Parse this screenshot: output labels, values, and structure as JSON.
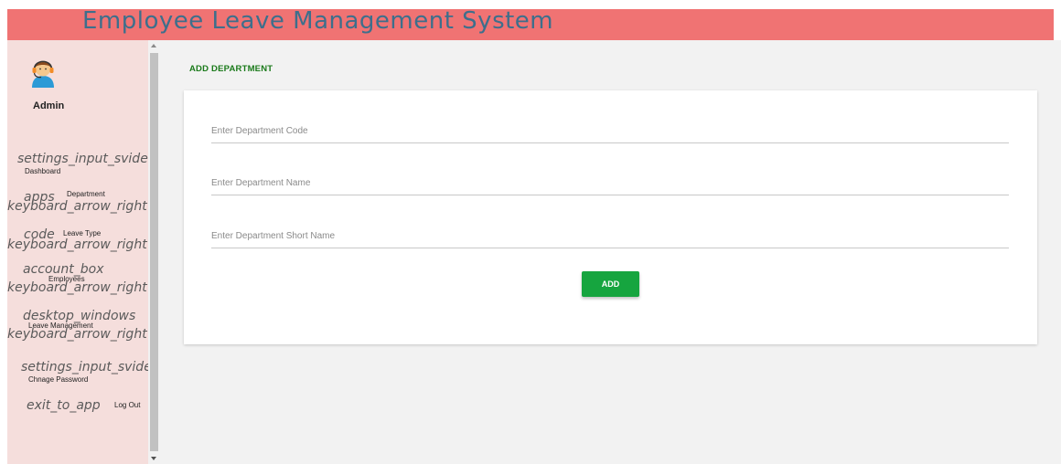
{
  "header": {
    "title": "Employee Leave Management System",
    "bg_color": "#f07373"
  },
  "sidebar": {
    "avatar_icon": "support-agent-avatar-icon",
    "user_name": "Admin",
    "items": [
      {
        "icon": "settings_input_svideo",
        "label": "Dashboard",
        "arrow": ""
      },
      {
        "icon": "apps",
        "label": "Department",
        "arrow": "keyboard_arrow_right"
      },
      {
        "icon": "code",
        "label": "Leave Type",
        "arrow": "keyboard_arrow_right"
      },
      {
        "icon": "account_box",
        "label": "Employees",
        "arrow": "keyboard_arrow_right"
      },
      {
        "icon": "desktop_windows",
        "label": "Leave Management",
        "arrow": "keyboard_arrow_right"
      },
      {
        "icon": "settings_input_svideo",
        "label": "Chnage Password",
        "arrow": ""
      },
      {
        "icon": "exit_to_app",
        "label": "Log Out",
        "arrow": ""
      }
    ]
  },
  "main": {
    "page_title": "ADD DEPARTMENT",
    "form": {
      "code_placeholder": "Enter Department Code",
      "name_placeholder": "Enter Department Name",
      "short_name_placeholder": "Enter Department Short Name",
      "submit_label": "ADD"
    }
  },
  "colors": {
    "accent": "#16a53f",
    "title_green": "#1a7a1a",
    "sidebar_bg": "#f5dedc"
  }
}
